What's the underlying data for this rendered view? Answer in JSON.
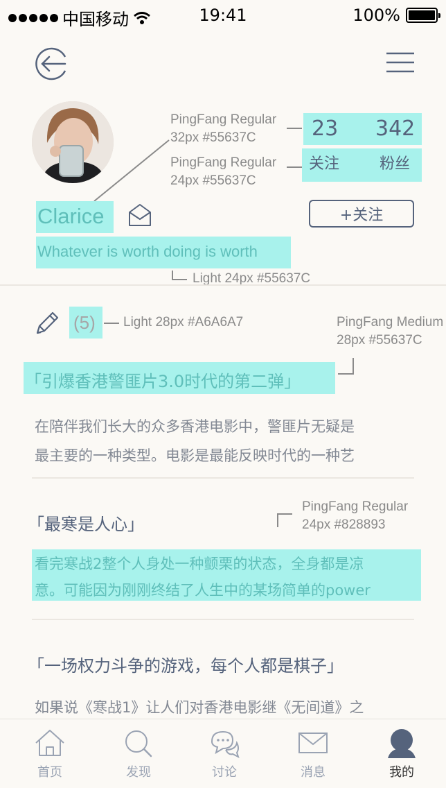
{
  "status": {
    "carrier": "中国移动",
    "time": "19:41",
    "battery": "100%"
  },
  "profile": {
    "name": "Clarice",
    "bio": "Whatever is worth doing is worth",
    "follow_button": "+关注",
    "stats": [
      {
        "count": "23",
        "label": "关注"
      },
      {
        "count": "342",
        "label": "粉丝"
      }
    ]
  },
  "section": {
    "count": "(5)"
  },
  "articles": [
    {
      "title": "「引爆香港警匪片3.0时代的第二弹」",
      "lines": [
        "在陪伴我们长大的众多香港电影中，警匪片无疑是",
        "最主要的一种类型。电影是最能反映时代的一种艺"
      ]
    },
    {
      "title": "「最寒是人心」",
      "lines": [
        "看完寒战2整个人身处一种颤栗的状态，全身都是凉",
        "意。可能因为刚刚终结了人生中的某场简单的power"
      ]
    },
    {
      "title": "「一场权力斗争的游戏，每个人都是棋子」",
      "lines": [
        "如果说《寒战1》让人们对香港电影继《无间道》之"
      ]
    }
  ],
  "annotations": {
    "stat_count_spec": [
      "PingFang Regular",
      "32px #55637C"
    ],
    "stat_label_spec": [
      "PingFang Regular",
      "24px #55637C"
    ],
    "bio_spec": "Light 24px #55637C",
    "count_spec": "Light 28px #A6A6A7",
    "title_spec": [
      "PingFang Medium",
      "28px #55637C"
    ],
    "body_spec": [
      "PingFang Regular",
      "24px #828893"
    ]
  },
  "tabbar": [
    {
      "label": "首页",
      "icon": "home-icon"
    },
    {
      "label": "发现",
      "icon": "search-icon"
    },
    {
      "label": "讨论",
      "icon": "chat-icon"
    },
    {
      "label": "消息",
      "icon": "mail-icon"
    },
    {
      "label": "我的",
      "icon": "user-icon"
    }
  ],
  "colors": {
    "primary": "#55637C",
    "highlight": "#A8F2EC",
    "muted": "#A6A6A7",
    "body": "#828893",
    "background": "#FBF9F5"
  }
}
